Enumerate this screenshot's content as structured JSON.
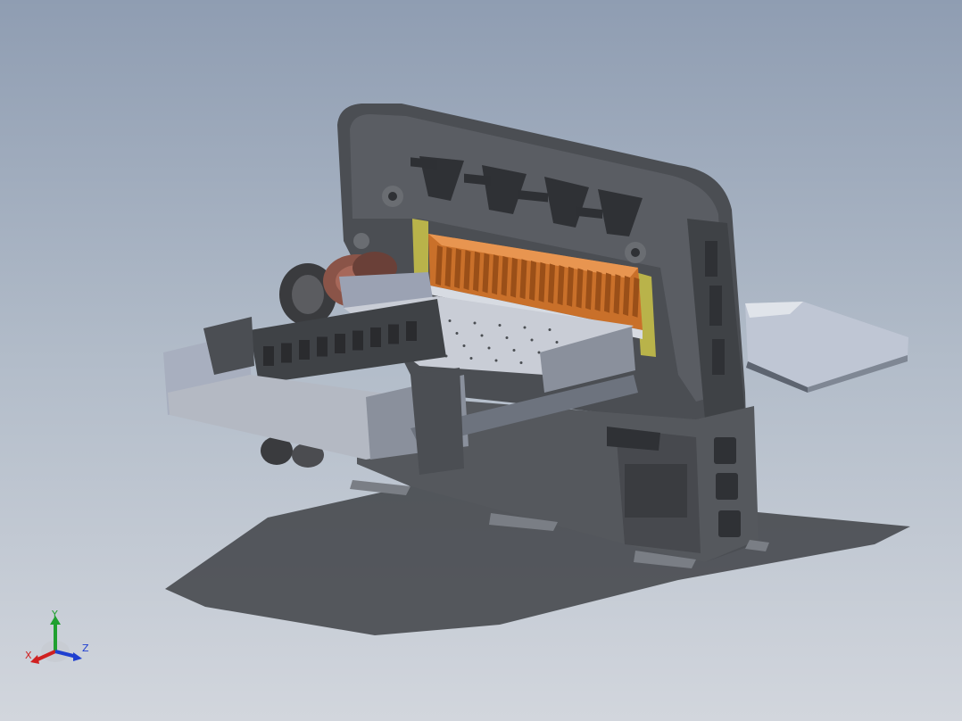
{
  "viewport": {
    "background_top": "#8f9db2",
    "background_bottom": "#d2d6dd"
  },
  "model": {
    "frame_color": "#4a4d52",
    "blade_color": "#d9772e",
    "table_color": "#9ea5b6",
    "shadow_color": "#3c3f44"
  },
  "triad": {
    "x_label": "X",
    "y_label": "Y",
    "z_label": "Z",
    "x_color": "#d02020",
    "y_color": "#20a030",
    "z_color": "#2040d0"
  }
}
